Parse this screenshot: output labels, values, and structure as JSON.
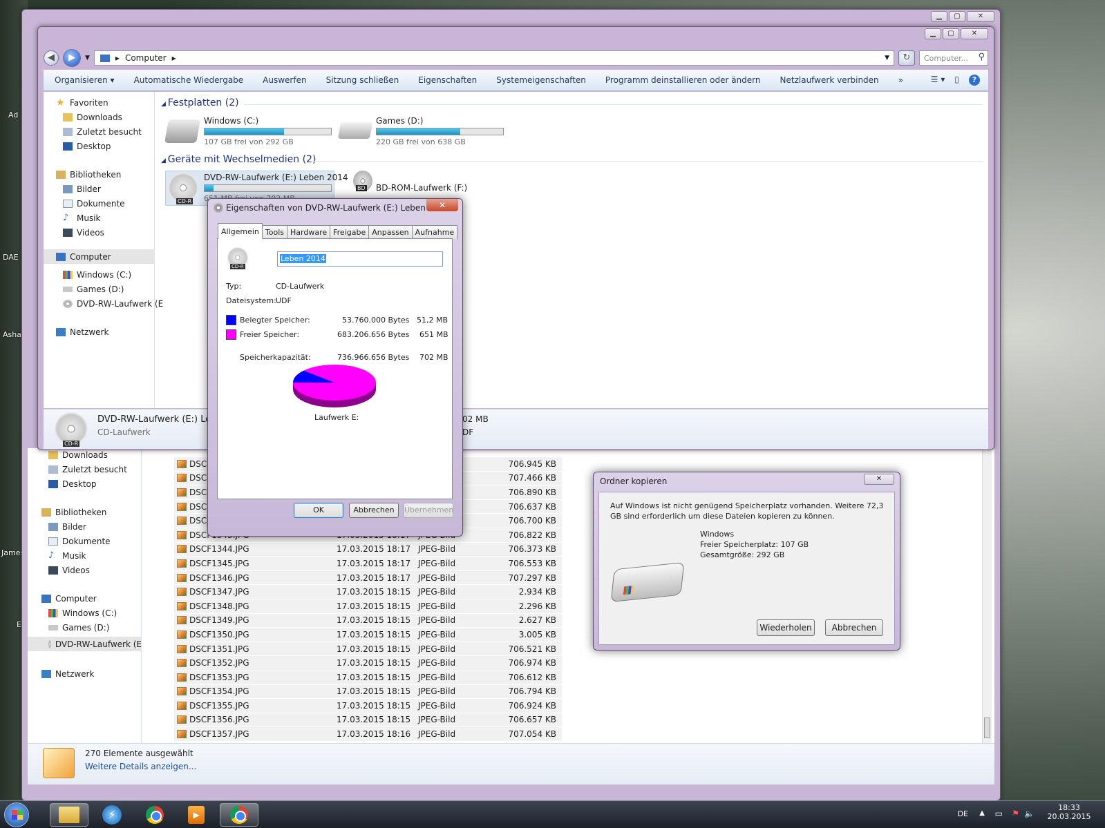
{
  "desktop": {
    "labels": [
      "Ad",
      "DAE",
      "Asha",
      "James",
      "E"
    ]
  },
  "back_window": {
    "nav": {
      "downloads": "Downloads",
      "recent": "Zuletzt besucht",
      "desktop": "Desktop",
      "libraries": "Bibliotheken",
      "pictures": "Bilder",
      "documents": "Dokumente",
      "music": "Musik",
      "videos": "Videos",
      "computer": "Computer",
      "windows": "Windows (C:)",
      "games": "Games (D:)",
      "dvd": "DVD-RW-Laufwerk (E",
      "network": "Netzwerk"
    },
    "files": [
      {
        "name": "DSCF1338.J",
        "date": "",
        "type": "",
        "size": "706.945 KB"
      },
      {
        "name": "DSCF1339.J",
        "date": "",
        "type": "",
        "size": "707.466 KB"
      },
      {
        "name": "DSCF1340.J",
        "date": "",
        "type": "",
        "size": "706.890 KB"
      },
      {
        "name": "DSCF1341.J",
        "date": "",
        "type": "",
        "size": "706.637 KB"
      },
      {
        "name": "DSCF1342.J",
        "date": "",
        "type": "",
        "size": "706.700 KB"
      },
      {
        "name": "DSCF1343.JPG",
        "date": "17.03.2015 18:17",
        "type": "JPEG-Bild",
        "size": "706.822 KB"
      },
      {
        "name": "DSCF1344.JPG",
        "date": "17.03.2015 18:17",
        "type": "JPEG-Bild",
        "size": "706.373 KB"
      },
      {
        "name": "DSCF1345.JPG",
        "date": "17.03.2015 18:17",
        "type": "JPEG-Bild",
        "size": "706.553 KB"
      },
      {
        "name": "DSCF1346.JPG",
        "date": "17.03.2015 18:17",
        "type": "JPEG-Bild",
        "size": "707.297 KB"
      },
      {
        "name": "DSCF1347.JPG",
        "date": "17.03.2015 18:15",
        "type": "JPEG-Bild",
        "size": "2.934 KB"
      },
      {
        "name": "DSCF1348.JPG",
        "date": "17.03.2015 18:15",
        "type": "JPEG-Bild",
        "size": "2.296 KB"
      },
      {
        "name": "DSCF1349.JPG",
        "date": "17.03.2015 18:15",
        "type": "JPEG-Bild",
        "size": "2.627 KB"
      },
      {
        "name": "DSCF1350.JPG",
        "date": "17.03.2015 18:15",
        "type": "JPEG-Bild",
        "size": "3.005 KB"
      },
      {
        "name": "DSCF1351.JPG",
        "date": "17.03.2015 18:15",
        "type": "JPEG-Bild",
        "size": "706.521 KB"
      },
      {
        "name": "DSCF1352.JPG",
        "date": "17.03.2015 18:15",
        "type": "JPEG-Bild",
        "size": "706.974 KB"
      },
      {
        "name": "DSCF1353.JPG",
        "date": "17.03.2015 18:15",
        "type": "JPEG-Bild",
        "size": "706.612 KB"
      },
      {
        "name": "DSCF1354.JPG",
        "date": "17.03.2015 18:15",
        "type": "JPEG-Bild",
        "size": "706.794 KB"
      },
      {
        "name": "DSCF1355.JPG",
        "date": "17.03.2015 18:15",
        "type": "JPEG-Bild",
        "size": "706.924 KB"
      },
      {
        "name": "DSCF1356.JPG",
        "date": "17.03.2015 18:15",
        "type": "JPEG-Bild",
        "size": "706.657 KB"
      },
      {
        "name": "DSCF1357.JPG",
        "date": "17.03.2015 18:16",
        "type": "JPEG-Bild",
        "size": "707.054 KB"
      }
    ],
    "status": {
      "selected": "270 Elemente ausgewählt",
      "more": "Weitere Details anzeigen..."
    }
  },
  "front_window": {
    "breadcrumb": "Computer",
    "search_placeholder": "Computer...",
    "toolbar": [
      "Organisieren",
      "Automatische Wiedergabe",
      "Auswerfen",
      "Sitzung schließen",
      "Eigenschaften",
      "Systemeigenschaften",
      "Programm deinstallieren oder ändern",
      "Netzlaufwerk verbinden",
      "»"
    ],
    "nav": {
      "favorites": "Favoriten",
      "downloads": "Downloads",
      "recent": "Zuletzt besucht",
      "desktop": "Desktop",
      "libraries": "Bibliotheken",
      "pictures": "Bilder",
      "documents": "Dokumente",
      "music": "Musik",
      "videos": "Videos",
      "computer": "Computer",
      "windows": "Windows (C:)",
      "games": "Games (D:)",
      "dvd": "DVD-RW-Laufwerk (E",
      "network": "Netzwerk"
    },
    "sections": {
      "hdd": "Festplatten (2)",
      "removable": "Geräte mit Wechselmedien (2)"
    },
    "drives": {
      "c": {
        "name": "Windows (C:)",
        "free": "107 GB frei von 292 GB",
        "fill": 0.63
      },
      "d": {
        "name": "Games (D:)",
        "free": "220 GB frei von 638 GB",
        "fill": 0.66
      },
      "e": {
        "name": "DVD-RW-Laufwerk (E:) Leben 2014",
        "free": "651 MB frei von 702 MB",
        "fill": 0.07
      },
      "f": {
        "name": "BD-ROM-Laufwerk (F:)"
      }
    },
    "details": {
      "name": "DVD-RW-Laufwerk (E:) Leben",
      "type": "CD-Laufwerk",
      "right1": "02 MB",
      "right2": "DF"
    },
    "icon_labels": {
      "cdr": "CD-R",
      "bd": "BD"
    }
  },
  "properties_dialog": {
    "title": "Eigenschaften von DVD-RW-Laufwerk (E:) Leben 2014",
    "tabs": [
      "Allgemein",
      "Tools",
      "Hardware",
      "Freigabe",
      "Anpassen",
      "Aufnahme"
    ],
    "label_value": "Leben 2014",
    "type_label": "Typ:",
    "type_value": "CD-Laufwerk",
    "fs_label": "Dateisystem:",
    "fs_value": "UDF",
    "used_label": "Belegter Speicher:",
    "used_bytes": "53.760.000 Bytes",
    "used_mb": "51,2 MB",
    "free_label": "Freier Speicher:",
    "free_bytes": "683.206.656 Bytes",
    "free_mb": "651 MB",
    "cap_label": "Speicherkapazität:",
    "cap_bytes": "736.966.656 Bytes",
    "cap_mb": "702 MB",
    "drive_label": "Laufwerk E:",
    "used_color": "#0000ff",
    "free_color": "#ff00ff",
    "used_fraction": 0.073,
    "ok": "OK",
    "cancel": "Abbrechen",
    "apply": "Übernehmen"
  },
  "copy_dialog": {
    "title": "Ordner kopieren",
    "message": "Auf Windows ist nicht genügend Speicherplatz vorhanden. Weitere 72,3 GB sind erforderlich um diese Dateien kopieren zu können.",
    "drive": "Windows",
    "free": "Freier Speicherplatz: 107 GB",
    "total": "Gesamtgröße: 292 GB",
    "retry": "Wiederholen",
    "cancel": "Abbrechen"
  },
  "taskbar": {
    "lang": "DE",
    "time": "18:33",
    "date": "20.03.2015"
  }
}
